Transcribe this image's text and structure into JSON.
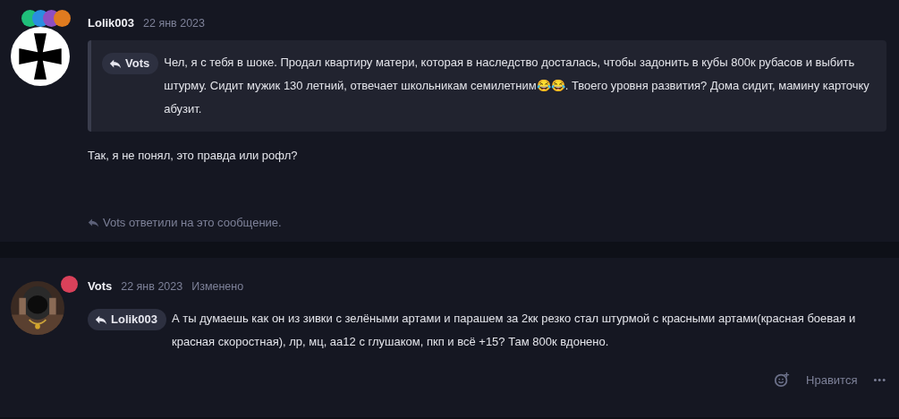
{
  "posts": [
    {
      "author": "Lolik003",
      "date": "22 янв 2023",
      "avatar": {
        "kind": "cross"
      },
      "badges": [
        {
          "color": "#1fbf7a"
        },
        {
          "color": "#2a8ee0"
        },
        {
          "color": "#8e4fc2"
        },
        {
          "color": "#e07b1f"
        }
      ],
      "quote": {
        "author": "Vots",
        "text": "Чел, я с тебя в шоке. Продал квартиру матери, которая в наследство досталась, чтобы задонить в кубы 800к рубасов и выбить штурму. Сидит мужик 130 летний, отвечает школьникам семилетним😂😂. Твоего уровня развития? Дома сидит, мамину карточку абузит."
      },
      "text": "Так, я не понял, это правда или рофл?",
      "replies": "Vots ответили на это сообщение."
    },
    {
      "author": "Vots",
      "date": "22 янв 2023",
      "edited": "Изменено",
      "avatar": {
        "kind": "picture"
      },
      "badges": [
        {
          "color": "#d9415a"
        }
      ],
      "reply_to": "Lolik003",
      "text": "А ты думаешь как он из зивки с зелёными артами и парашем за 2кк резко стал штурмой с красными артами(красная боевая и красная скоростная), лр, мц, аа12 с глушаком, пкп и всё +15? Там 800к вдонено.",
      "like": "Нравится",
      "more": "•••"
    }
  ]
}
